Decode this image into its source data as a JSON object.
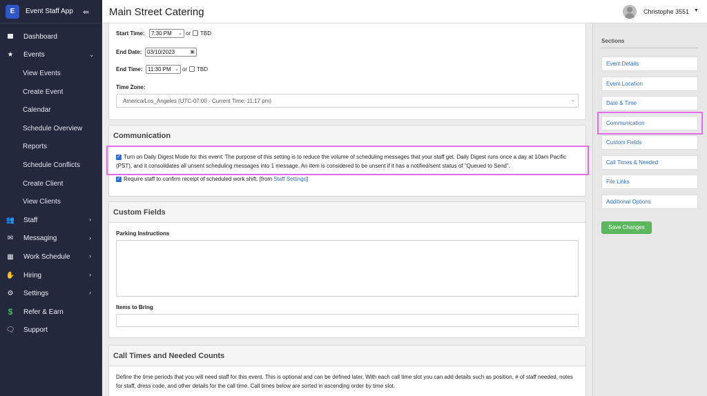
{
  "app": {
    "logo_letter": "E",
    "name": "Event Staff App",
    "collapse_icon": "collapse-sidebar-icon"
  },
  "sidebar": {
    "items": [
      {
        "label": "Dashboard",
        "icon": "dashboard-icon"
      },
      {
        "label": "Events",
        "icon": "star-icon",
        "expanded": true
      },
      {
        "label": "View Events"
      },
      {
        "label": "Create Event"
      },
      {
        "label": "Calendar"
      },
      {
        "label": "Schedule Overview"
      },
      {
        "label": "Reports"
      },
      {
        "label": "Schedule Conflicts"
      },
      {
        "label": "Create Client"
      },
      {
        "label": "View Clients"
      },
      {
        "label": "Staff",
        "icon": "users-icon"
      },
      {
        "label": "Messaging",
        "icon": "envelope-icon"
      },
      {
        "label": "Work Schedule",
        "icon": "calendar-icon"
      },
      {
        "label": "Hiring",
        "icon": "hand-icon"
      },
      {
        "label": "Settings",
        "icon": "gear-icon"
      },
      {
        "label": "Refer & Earn",
        "icon": "dollar-icon"
      },
      {
        "label": "Support",
        "icon": "support-icon"
      }
    ]
  },
  "header": {
    "title": "Main Street Catering",
    "user_name": "Christophe 3551"
  },
  "datetime": {
    "start_time_label": "Start Time:",
    "start_time_value": "7:30 PM",
    "or_text": "or",
    "tbd_label": "TBD",
    "end_date_label": "End Date:",
    "end_date_value": "03/10/2023",
    "end_time_label": "End Time:",
    "end_time_value": "11:30 PM",
    "timezone_label": "Time Zone:",
    "timezone_value": "America/Los_Angeles (UTC-07:00 - Current Time: 11:17 pm)"
  },
  "communication": {
    "title": "Communication",
    "digest_text": "Turn on Daily Digest Mode for this event: The purpose of this setting is to reduce the volume of scheduling messages that your staff get. Daily Digest runs once a day at 10am Pacific (PST), and it consolidates all unsent scheduling messages into 1 message. An item is considered to be unsent if it has a notified/sent status of \"Queued to Send\".",
    "digest_checked": true,
    "confirm_text": "Require staff to confirm receipt of scheduled work shift. [from",
    "confirm_link": "Staff Settings",
    "confirm_close": "]",
    "confirm_checked": true
  },
  "custom_fields": {
    "title": "Custom Fields",
    "parking_label": "Parking Instructions",
    "parking_value": "",
    "items_label": "Items to Bring",
    "items_value": ""
  },
  "call_times": {
    "title": "Call Times and Needed Counts",
    "description": "Define the time periods that you will need staff for this event. This is optional and can be defined later. With each call time slot you can add details such as position, # of staff needed, notes for staff, dress code, and other details for the call time. Call times below are sorted in ascending order by time slot."
  },
  "sections": {
    "title": "Sections",
    "items": [
      "Event Details",
      "Event Location",
      "Date & Time",
      "Communication",
      "Custom Fields",
      "Call Times & Needed",
      "File Links",
      "Additional Options"
    ],
    "highlighted": "Communication",
    "save_label": "Save Changes"
  },
  "colors": {
    "sidebar_bg": "#23283d",
    "highlight": "#e46be8",
    "link": "#2b6fd6",
    "save_button": "#5cb85c",
    "dollar_icon": "#3fbf5e"
  }
}
